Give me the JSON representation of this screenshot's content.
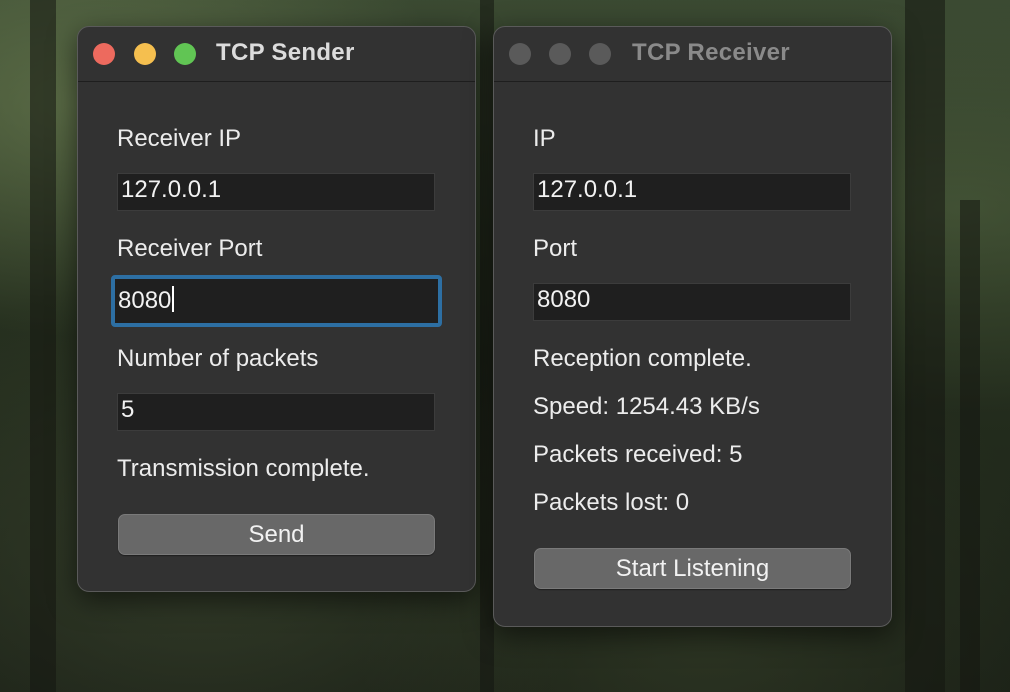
{
  "desktop": {
    "background": "forest-wallpaper"
  },
  "sender": {
    "title": "TCP Sender",
    "traffic_lights": {
      "close": "#ed6a5e",
      "minimize": "#f5bf4f",
      "zoom": "#61c554"
    },
    "receiver_ip_label": "Receiver IP",
    "receiver_ip_value": "127.0.0.1",
    "receiver_port_label": "Receiver Port",
    "receiver_port_value": "8080",
    "packets_label": "Number of packets",
    "packets_value": "5",
    "status": "Transmission complete.",
    "send_label": "Send"
  },
  "receiver": {
    "title": "TCP Receiver",
    "traffic_lights": {
      "inactive": "#5a5a5a"
    },
    "ip_label": "IP",
    "ip_value": "127.0.0.1",
    "port_label": "Port",
    "port_value": "8080",
    "status": "Reception complete.",
    "speed": "Speed: 1254.43 KB/s",
    "packets_received": "Packets received: 5",
    "packets_lost": "Packets lost: 0",
    "start_label": "Start Listening"
  },
  "colors": {
    "focus_ring": "#2d6fa3",
    "window_bg": "#323232",
    "field_bg": "#1f1f1f"
  }
}
